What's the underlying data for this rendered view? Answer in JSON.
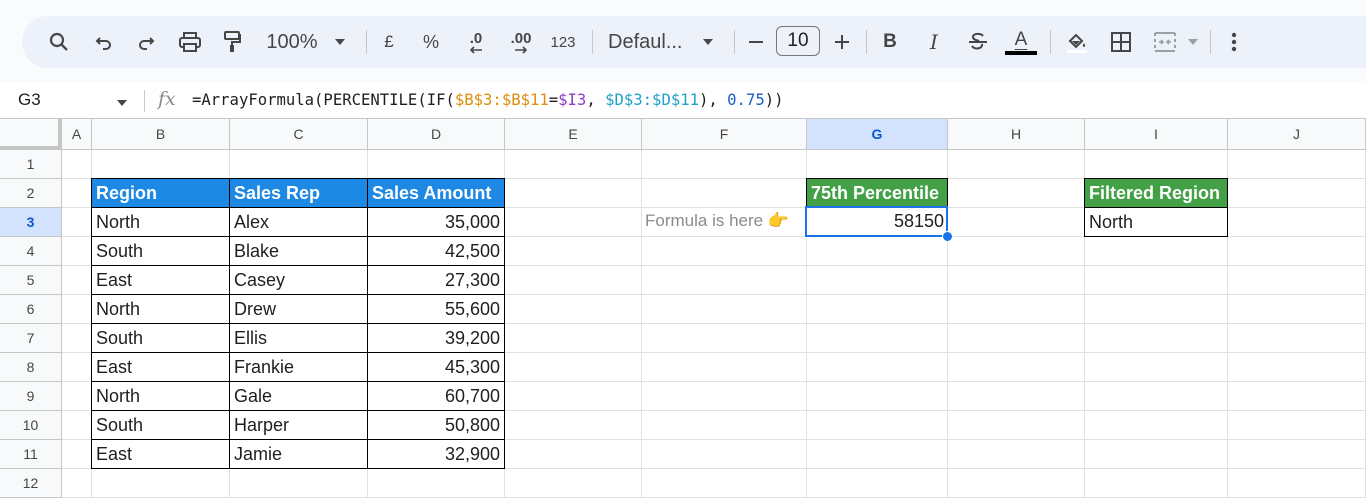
{
  "toolbar": {
    "zoom": "100%",
    "currency": "£",
    "percent": "%",
    "decrease_decimal": ".0",
    "increase_decimal": ".00",
    "number_format": "123",
    "font_name": "Defaul...",
    "font_size": "10",
    "bold": "B",
    "italic": "I",
    "text_color_glyph": "A"
  },
  "formula_bar": {
    "name_box": "G3",
    "fx": "fx",
    "formula_parts": [
      "=ArrayFormula(PERCENTILE(IF(",
      "$B$3:$B$11",
      "=",
      "$I3",
      ", ",
      "$D$3:$D$11",
      "), ",
      "0.75",
      "))"
    ]
  },
  "columns": [
    "A",
    "B",
    "C",
    "D",
    "E",
    "F",
    "G",
    "H",
    "I",
    "J"
  ],
  "selected_column": "G",
  "rows": [
    "1",
    "2",
    "3",
    "4",
    "5",
    "6",
    "7",
    "8",
    "9",
    "10",
    "11",
    "12"
  ],
  "selected_row": "3",
  "table": {
    "headers": [
      "Region",
      "Sales Rep",
      "Sales Amount"
    ],
    "rows": [
      [
        "North",
        "Alex",
        "35,000"
      ],
      [
        "South",
        "Blake",
        "42,500"
      ],
      [
        "East",
        "Casey",
        "27,300"
      ],
      [
        "North",
        "Drew",
        "55,600"
      ],
      [
        "South",
        "Ellis",
        "39,200"
      ],
      [
        "East",
        "Frankie",
        "45,300"
      ],
      [
        "North",
        "Gale",
        "60,700"
      ],
      [
        "South",
        "Harper",
        "50,800"
      ],
      [
        "East",
        "Jamie",
        "32,900"
      ]
    ]
  },
  "note": "Formula is here 👉",
  "percentile": {
    "header": "75th Percentile",
    "value": "58150"
  },
  "filter": {
    "header": "Filtered Region",
    "value": "North"
  },
  "colors": {
    "table_header": "#1e88e5",
    "result_header": "#43a047",
    "selection": "#1a73e8"
  }
}
